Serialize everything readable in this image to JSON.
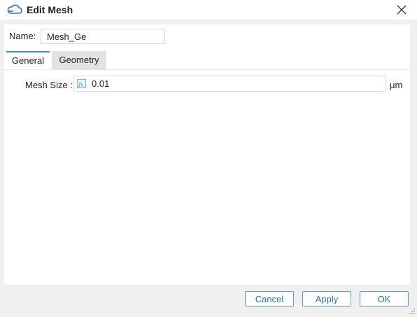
{
  "dialog": {
    "title": "Edit Mesh",
    "title_icon": "cloud-icon",
    "close_icon": "close-icon"
  },
  "name_field": {
    "label": "Name:",
    "value": "Mesh_Ge"
  },
  "tabs": [
    {
      "label": "General",
      "active": true
    },
    {
      "label": "Geometry",
      "active": false
    }
  ],
  "general": {
    "mesh_size": {
      "label": "Mesh Size :",
      "value": "0.01",
      "unit": "μm",
      "icon": "fx-icon"
    }
  },
  "buttons": {
    "cancel": "Cancel",
    "apply": "Apply",
    "ok": "OK"
  },
  "colors": {
    "accent": "#3f8fd6",
    "button_text": "#2d6fb3",
    "button_border": "#5b9bd5"
  }
}
